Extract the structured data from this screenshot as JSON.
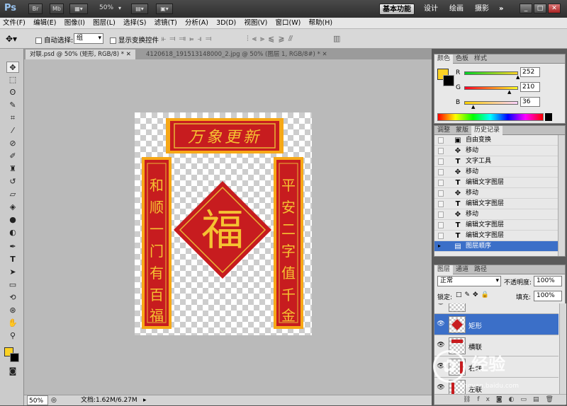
{
  "app": {
    "logo": "Ps",
    "zoom": "50%"
  },
  "appbar": {
    "btn_br": "Br",
    "btn_mb": "Mb",
    "workspaces": [
      "基本功能",
      "设计",
      "绘画",
      "摄影"
    ],
    "more": "»"
  },
  "menu": [
    "文件(F)",
    "编辑(E)",
    "图像(I)",
    "图层(L)",
    "选择(S)",
    "滤镜(T)",
    "分析(A)",
    "3D(D)",
    "视图(V)",
    "窗口(W)",
    "帮助(H)"
  ],
  "options": {
    "auto_select_label": "自动选择:",
    "auto_select_value": "组",
    "show_transform_label": "显示变换控件"
  },
  "tabs": [
    {
      "label": "对联.psd @ 50% (矩形, RGB/8) *",
      "active": true
    },
    {
      "label": "4120618_191513148000_2.jpg @ 50% (图层 1, RGB/8#) *",
      "active": false
    }
  ],
  "artwork": {
    "banner": "万象更新",
    "left_couplet": [
      "和",
      "顺",
      "一",
      "门",
      "有",
      "百",
      "福"
    ],
    "right_couplet": [
      "平",
      "安",
      "二",
      "字",
      "值",
      "千",
      "金"
    ],
    "center": "福"
  },
  "status": {
    "zoom": "50%",
    "doc_info": "文档:1.62M/6.27M"
  },
  "color_panel": {
    "tabs": [
      "颜色",
      "色板",
      "样式"
    ],
    "channels": [
      {
        "label": "R",
        "value": "252",
        "level": 0.988
      },
      {
        "label": "G",
        "value": "210",
        "level": 0.824
      },
      {
        "label": "B",
        "value": "36",
        "level": 0.141
      }
    ],
    "foreground": "#fcd224",
    "background": "#000000"
  },
  "history_panel": {
    "tabs": [
      "调整",
      "蒙版",
      "历史记录"
    ],
    "items": [
      {
        "label": "自由变换",
        "icon": "transform-icon"
      },
      {
        "label": "移动",
        "icon": "move-icon"
      },
      {
        "label": "文字工具",
        "icon": "text-icon"
      },
      {
        "label": "移动",
        "icon": "move-icon"
      },
      {
        "label": "编辑文字图层",
        "icon": "text-icon"
      },
      {
        "label": "移动",
        "icon": "move-icon"
      },
      {
        "label": "编辑文字图层",
        "icon": "text-icon"
      },
      {
        "label": "移动",
        "icon": "move-icon"
      },
      {
        "label": "编辑文字图层",
        "icon": "text-icon"
      },
      {
        "label": "编辑文字图层",
        "icon": "text-icon"
      },
      {
        "label": "图层顺序",
        "icon": "layer-order-icon",
        "selected": true
      }
    ]
  },
  "layers_panel": {
    "tabs": [
      "图层",
      "通道",
      "路径"
    ],
    "blend_mode": "正常",
    "opacity_label": "不透明度:",
    "opacity_value": "100%",
    "lock_label": "锁定:",
    "fill_label": "填充:",
    "fill_value": "100%",
    "layers": [
      {
        "name": "",
        "selected": false
      },
      {
        "name": "矩形",
        "selected": true
      },
      {
        "name": "横联",
        "selected": false
      },
      {
        "name": "右联",
        "selected": false
      },
      {
        "name": "左联",
        "selected": false
      }
    ]
  },
  "watermark": {
    "text": "经验",
    "url": "jingyan.baidu.com"
  }
}
